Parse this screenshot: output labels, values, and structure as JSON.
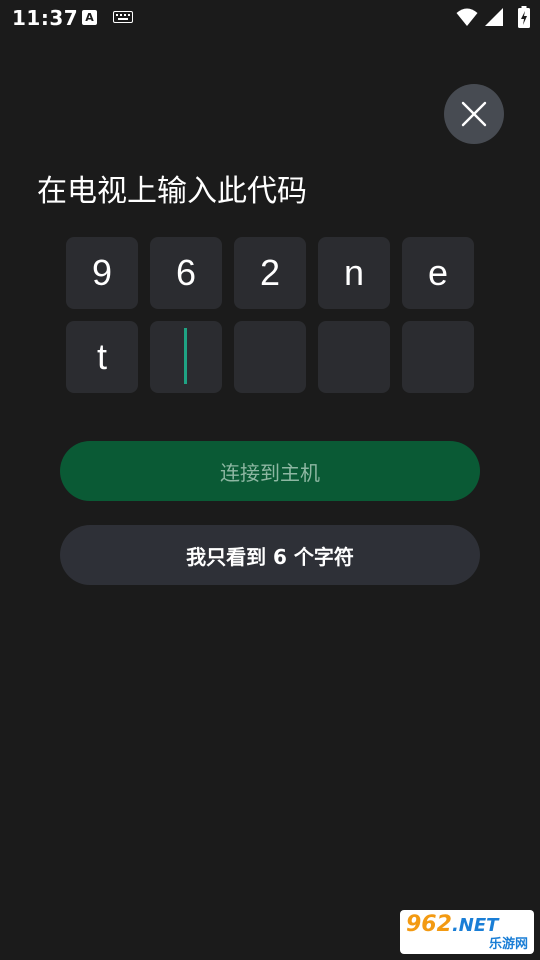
{
  "status_bar": {
    "time": "11:37",
    "notification_badge": "A",
    "icons": [
      "a-notification-icon",
      "keyboard-icon",
      "wifi-icon",
      "signal-icon",
      "battery-charging-icon"
    ]
  },
  "dialog": {
    "close_icon": "close-icon",
    "title": "在电视上输入此代码",
    "code_cells": [
      "9",
      "6",
      "2",
      "n",
      "e",
      "t",
      "",
      "",
      "",
      ""
    ],
    "active_cell_index": 6,
    "connect_button_label": "连接到主机",
    "six_chars_button_label": "我只看到 6 个字符"
  },
  "watermark": {
    "main": "962",
    "suffix": ".NET",
    "sub": "乐游网"
  },
  "colors": {
    "background": "#1b1b1b",
    "cell_background": "#2b2c30",
    "cursor": "#1fa383",
    "primary_button": "#0a5a35",
    "primary_button_text": "#8db7a2",
    "secondary_button": "#2e3037",
    "close_button": "#474b52"
  }
}
